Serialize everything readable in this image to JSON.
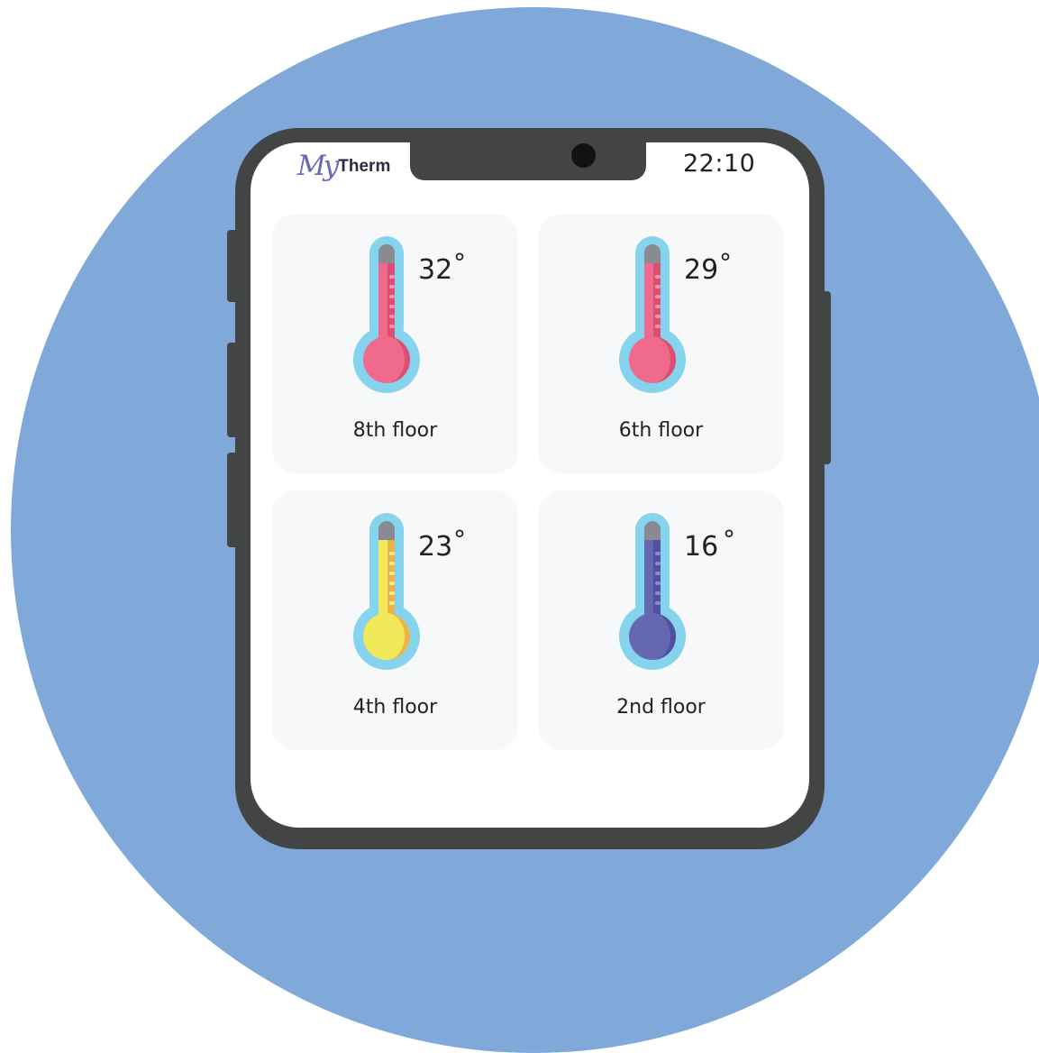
{
  "app": {
    "logo_my": "My",
    "logo_therm": "Therm",
    "time": "22:10"
  },
  "colors": {
    "background_circle": "#80a8d8",
    "phone_frame": "#434545",
    "card_bg": "#f7f8fa",
    "thermo_outline": "#85d3ec",
    "hot": "#f06a8d",
    "warm": "#f1e85a",
    "cold": "#6667b1"
  },
  "icons": {
    "thermometer": "thermometer-icon",
    "camera": "front-camera-icon"
  },
  "floors": [
    {
      "label": "8th floor",
      "temperature": "32",
      "degree": "°",
      "level": "hot"
    },
    {
      "label": "6th floor",
      "temperature": "29",
      "degree": "°",
      "level": "hot"
    },
    {
      "label": "4th floor",
      "temperature": "23",
      "degree": "°",
      "level": "warm"
    },
    {
      "label": "2nd floor",
      "temperature": "16",
      "degree": "°",
      "level": "cold"
    }
  ]
}
